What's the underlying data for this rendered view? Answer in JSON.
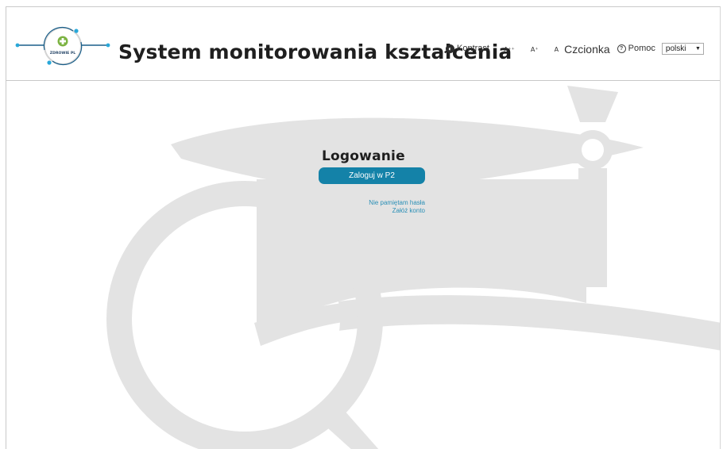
{
  "header": {
    "logo_text": "ZDROWIE PL",
    "title": "System monitorowania kształcenia"
  },
  "toolbar": {
    "contrast_label": "Kontrast",
    "font_large": "A⁺⁺",
    "font_medium": "A⁺",
    "font_small": "A",
    "font_label": "Czcionka",
    "help_label": "Pomoc",
    "language_value": "polski"
  },
  "login": {
    "title": "Logowanie",
    "button_label": "Zaloguj w P2",
    "forgot_password": "Nie pamiętam hasła",
    "create_account": "Załóż konto"
  },
  "icons": {
    "contrast": "contrast-icon",
    "help": "help-icon",
    "dropdown": "chevron-down-icon",
    "watermark": "graduation-cap-magnifier-icon"
  },
  "colors": {
    "accent": "#1482a8",
    "link": "#2a8fb6",
    "watermark": "#e3e3e3",
    "logo_green": "#7cb342",
    "logo_line": "#1a5f8a",
    "logo_dot": "#29a8d9"
  }
}
